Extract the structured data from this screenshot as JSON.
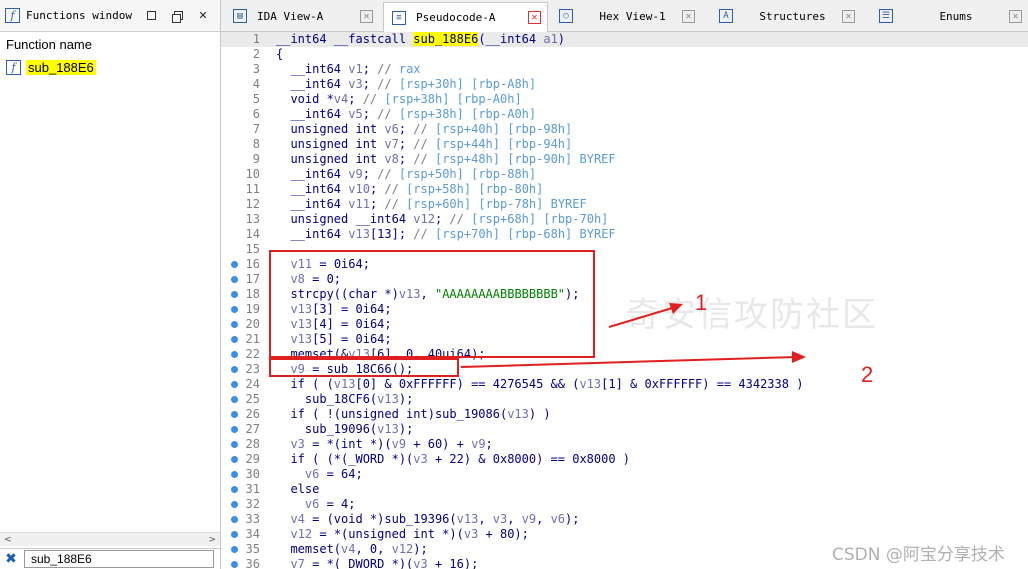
{
  "left_panel": {
    "title": "Functions window",
    "column_header": "Function name",
    "functions": [
      "sub_188E6"
    ],
    "filter_value": "sub_188E6"
  },
  "tabs": [
    {
      "label": "IDA View-A",
      "icon": "graph-icon",
      "active": false
    },
    {
      "label": "Pseudocode-A",
      "icon": "pseudocode-icon",
      "active": true
    },
    {
      "label": "Hex View-1",
      "icon": "hex-icon",
      "active": false
    },
    {
      "label": "Structures",
      "icon": "structures-icon",
      "active": false
    },
    {
      "label": "Enums",
      "icon": "enums-icon",
      "active": false
    }
  ],
  "code_lines": [
    {
      "n": "1",
      "text": "__int64 __fastcall sub_188E6(__int64 a1)"
    },
    {
      "n": "2",
      "text": "{"
    },
    {
      "n": "3",
      "text": "  __int64 v1; // rax"
    },
    {
      "n": "4",
      "text": "  __int64 v3; // [rsp+30h] [rbp-A8h]"
    },
    {
      "n": "5",
      "text": "  void *v4; // [rsp+38h] [rbp-A0h]"
    },
    {
      "n": "6",
      "text": "  __int64 v5; // [rsp+38h] [rbp-A0h]"
    },
    {
      "n": "7",
      "text": "  unsigned int v6; // [rsp+40h] [rbp-98h]"
    },
    {
      "n": "8",
      "text": "  unsigned int v7; // [rsp+44h] [rbp-94h]"
    },
    {
      "n": "9",
      "text": "  unsigned int v8; // [rsp+48h] [rbp-90h] BYREF"
    },
    {
      "n": "10",
      "text": "  __int64 v9; // [rsp+50h] [rbp-88h]"
    },
    {
      "n": "11",
      "text": "  __int64 v10; // [rsp+58h] [rbp-80h]"
    },
    {
      "n": "12",
      "text": "  __int64 v11; // [rsp+60h] [rbp-78h] BYREF"
    },
    {
      "n": "13",
      "text": "  unsigned __int64 v12; // [rsp+68h] [rbp-70h]"
    },
    {
      "n": "14",
      "text": "  __int64 v13[13]; // [rsp+70h] [rbp-68h] BYREF"
    },
    {
      "n": "15",
      "text": ""
    },
    {
      "n": "16",
      "text": "  v11 = 0i64;"
    },
    {
      "n": "17",
      "text": "  v8 = 0;"
    },
    {
      "n": "18",
      "text": "  strcpy((char *)v13, \"AAAAAAAABBBBBBBB\");"
    },
    {
      "n": "19",
      "text": "  v13[3] = 0i64;"
    },
    {
      "n": "20",
      "text": "  v13[4] = 0i64;"
    },
    {
      "n": "21",
      "text": "  v13[5] = 0i64;"
    },
    {
      "n": "22",
      "text": "  memset(&v13[6], 0, 40ui64);"
    },
    {
      "n": "23",
      "text": "  v9 = sub_18C66();"
    },
    {
      "n": "24",
      "text": "  if ( (v13[0] & 0xFFFFFF) == 4276545 && (v13[1] & 0xFFFFFF) == 4342338 )"
    },
    {
      "n": "25",
      "text": "    sub_18CF6(v13);"
    },
    {
      "n": "26",
      "text": "  if ( !(unsigned int)sub_19086(v13) )"
    },
    {
      "n": "27",
      "text": "    sub_19096(v13);"
    },
    {
      "n": "28",
      "text": "  v3 = *(int *)(v9 + 60) + v9;"
    },
    {
      "n": "29",
      "text": "  if ( (*(_WORD *)(v3 + 22) & 0x8000) == 0x8000 )"
    },
    {
      "n": "30",
      "text": "    v6 = 64;"
    },
    {
      "n": "31",
      "text": "  else"
    },
    {
      "n": "32",
      "text": "    v6 = 4;"
    },
    {
      "n": "33",
      "text": "  v4 = (void *)sub_19396(v13, v3, v9, v6);"
    },
    {
      "n": "34",
      "text": "  v12 = *(unsigned int *)(v3 + 80);"
    },
    {
      "n": "35",
      "text": "  memset(v4, 0, v12);"
    },
    {
      "n": "36",
      "text": "  v7 = *(_DWORD *)(v3 + 16);"
    }
  ],
  "annotations": {
    "label_1": "1",
    "label_2": "2"
  },
  "watermark": "奇安信攻防社区",
  "credit": "CSDN @阿宝分享技术"
}
